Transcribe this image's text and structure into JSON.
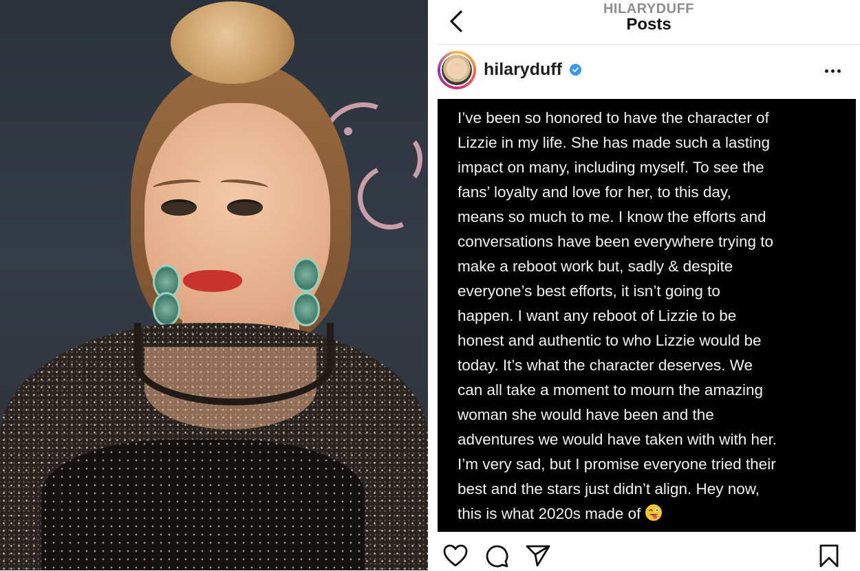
{
  "photo": {
    "subject": "woman-portrait",
    "background_color": "#2f3640",
    "watermark_color": "#d9a9b2"
  },
  "instagram": {
    "header": {
      "username": "HILARYDUFF",
      "title": "Posts",
      "back_icon": "chevron-left-icon"
    },
    "post": {
      "username": "hilaryduff",
      "verified": true,
      "verified_color": "#3897f0",
      "more_icon": "more-horizontal-icon",
      "caption_lines": [
        "I’ve been so honored to have the character of",
        "Lizzie in my life. She has made such a lasting",
        "impact on many, including myself. To see the",
        "fans’ loyalty and love for her, to this day,",
        "means so much to me. I know the efforts and",
        "conversations have been everywhere trying to",
        "make a reboot work but, sadly & despite",
        "everyone’s best efforts, it isn’t going to",
        "happen. I want any reboot of Lizzie to be",
        "honest and authentic to who Lizzie would be",
        "today. It’s what the character deserves. We",
        "can all take a moment to mourn the amazing",
        "woman she would have been and the",
        "adventures we would have taken with with her.",
        "I’m very sad, but I promise everyone tried their",
        "best and the stars just didn’t align. Hey now,",
        "this is what 2020s made of"
      ],
      "caption_emoji": "winking-face-with-tongue-icon",
      "post_background": "#000000",
      "text_color": "#f2f2f2"
    },
    "actions": {
      "like": "heart-icon",
      "comment": "comment-icon",
      "share": "paper-plane-icon",
      "save": "bookmark-icon"
    }
  }
}
